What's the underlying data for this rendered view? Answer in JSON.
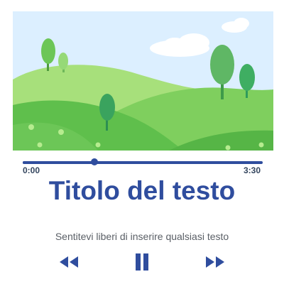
{
  "player": {
    "time_current": "0:00",
    "time_total": "3:30",
    "progress_fraction": 0.3,
    "title": "Titolo del testo",
    "subtitle": "Sentitevi liberi di inserire qualsiasi testo",
    "accent_color": "#2f4d9e",
    "controls": {
      "previous_icon": "rewind-icon",
      "play_pause_icon": "pause-icon",
      "next_icon": "fast-forward-icon"
    }
  }
}
